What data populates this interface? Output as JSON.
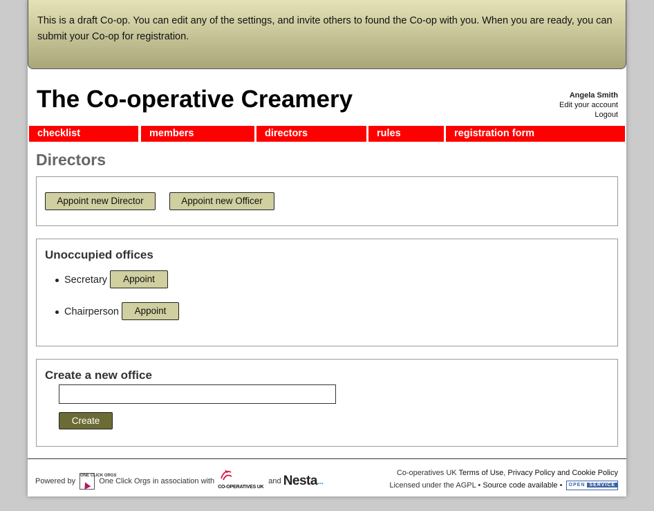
{
  "banner": {
    "text": "This is a draft Co-op. You can edit any of the settings, and invite others to found the Co-op with you. When you are ready, you can submit your Co-op for registration."
  },
  "header": {
    "org_name": "The Co-operative Creamery",
    "user_name": "Angela Smith",
    "edit_account": "Edit your account",
    "logout": "Logout"
  },
  "nav": {
    "items": [
      {
        "label": "checklist"
      },
      {
        "label": "members"
      },
      {
        "label": "directors"
      },
      {
        "label": "rules"
      },
      {
        "label": "registration form"
      }
    ]
  },
  "main": {
    "title": "Directors",
    "actions": {
      "appoint_director": "Appoint new Director",
      "appoint_officer": "Appoint new Officer"
    },
    "unoccupied": {
      "heading": "Unoccupied offices",
      "offices": [
        {
          "name": "Secretary",
          "button": "Appoint"
        },
        {
          "name": "Chairperson",
          "button": "Appoint"
        }
      ]
    },
    "create_office": {
      "heading": "Create a new office",
      "input_value": "",
      "button": "Create"
    }
  },
  "footer": {
    "powered_by": "Powered by",
    "oco_logo_text": "ONE CLICK ORGS",
    "oco_name": "One Click Orgs",
    "in_association": "in association with",
    "coop_logo_text": "CO-OPERATIVES UK",
    "and": "and",
    "nesta": "Nesta",
    "nesta_dots": "...",
    "coops_uk": "Co-operatives UK",
    "terms": "Terms of Use",
    "comma": ",",
    "privacy": "Privacy Policy and Cookie Policy",
    "licensed": "Licensed under the AGPL",
    "sep": "•",
    "source": "Source code available",
    "sep2": "•",
    "badge_left": "OPEN",
    "badge_right": "SERVICE"
  },
  "colors": {
    "nav_bg": "#ff0000",
    "button_olive": "#cfcf9f",
    "button_dark_olive": "#6b6b35",
    "banner_top": "#e4e2b6",
    "banner_bottom": "#a9a77a"
  }
}
